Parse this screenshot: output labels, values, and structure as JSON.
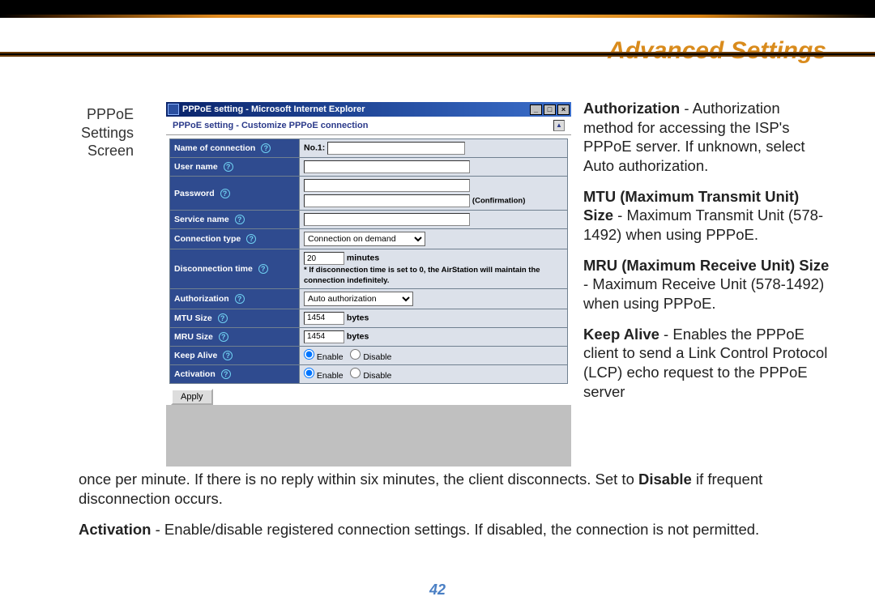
{
  "page_title": "Advanced Settings",
  "page_number": "42",
  "caption": {
    "l1": "PPPoE",
    "l2": "Settings",
    "l3": "Screen"
  },
  "ie": {
    "title": "PPPoE setting - Microsoft Internet Explorer",
    "subtitle": "PPPoE setting - Customize PPPoE connection",
    "min": "_",
    "max": "□",
    "close": "×",
    "scroll_up": "▲",
    "rows": {
      "name_label": "Name of connection",
      "name_prefix": "No.1:",
      "user_label": "User name",
      "pass_label": "Password",
      "confirm": "(Confirmation)",
      "service_label": "Service name",
      "conn_label": "Connection type",
      "conn_value": "Connection on demand",
      "disc_label": "Disconnection time",
      "disc_value": "20",
      "disc_unit": "minutes",
      "disc_note": "* If disconnection time is set to 0, the AirStation will maintain the connection indefinitely.",
      "auth_label": "Authorization",
      "auth_value": "Auto authorization",
      "mtu_label": "MTU Size",
      "mtu_value": "1454",
      "mtu_unit": "bytes",
      "mru_label": "MRU Size",
      "mru_value": "1454",
      "mru_unit": "bytes",
      "ka_label": "Keep Alive",
      "act_label": "Activation",
      "enable": "Enable",
      "disable": "Disable"
    },
    "apply": "Apply",
    "help": "?"
  },
  "rcol": {
    "p1_b": "Authorization",
    "p1_t": " - Authorization method for accessing the ISP's PPPoE server.  If unknown, select Auto authorization.",
    "p2_b": "MTU (Maximum Transmit Unit) Size",
    "p2_t": " - Maximum Transmit Unit (578-1492) when using PPPoE.",
    "p3_b": "MRU (Maximum Receive Unit) Size",
    "p3_t": " - Maximum Receive Unit (578-1492) when using PPPoE.",
    "p4_b": "Keep Alive",
    "p4_t": " - Enables the PPPoE client to send a Link Control Protocol (LCP) echo request to the PPPoE server"
  },
  "below": {
    "p1_a": "once per minute.  If there is no reply within six minutes, the client disconnects.  Set to ",
    "p1_b": "Disable",
    "p1_c": " if frequent disconnection occurs.",
    "p2_b": "Activation",
    "p2_t": " - Enable/disable registered connection settings. If disabled, the connection is not permitted."
  }
}
